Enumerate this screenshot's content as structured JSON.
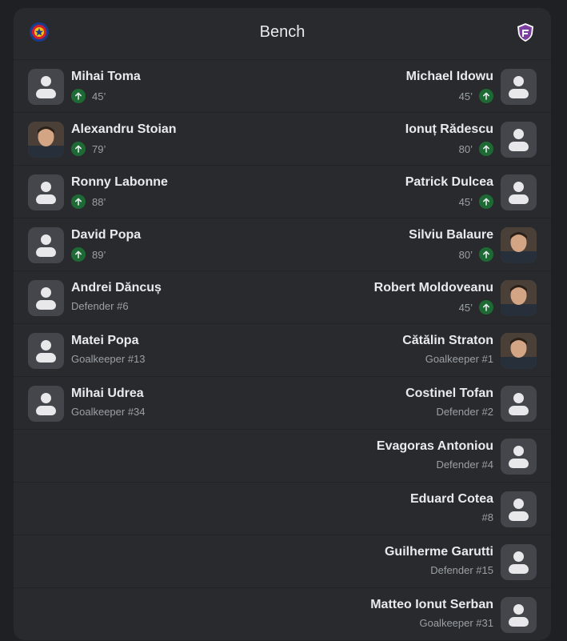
{
  "header": {
    "title": "Bench",
    "home_logo": "fcsb-crest-icon",
    "away_logo": "fc-arges-crest-icon"
  },
  "colors": {
    "card_bg": "#292a2d",
    "sub_arrow_bg": "#1e6a35",
    "text_primary": "#e8eaed",
    "text_secondary": "#9aa0a6"
  },
  "home": [
    {
      "name": "Mihai Toma",
      "sub": "45’",
      "subbed": true,
      "photo": false
    },
    {
      "name": "Alexandru Stoian",
      "sub": "79’",
      "subbed": true,
      "photo": true
    },
    {
      "name": "Ronny Labonne",
      "sub": "88’",
      "subbed": true,
      "photo": false
    },
    {
      "name": "David Popa",
      "sub": "89’",
      "subbed": true,
      "photo": false
    },
    {
      "name": "Andrei Dăncuș",
      "sub": "Defender #6",
      "subbed": false,
      "photo": false
    },
    {
      "name": "Matei Popa",
      "sub": "Goalkeeper #13",
      "subbed": false,
      "photo": false
    },
    {
      "name": "Mihai Udrea",
      "sub": "Goalkeeper #34",
      "subbed": false,
      "photo": false
    }
  ],
  "away": [
    {
      "name": "Michael Idowu",
      "sub": "45’",
      "subbed": true,
      "photo": false
    },
    {
      "name": "Ionuț Rădescu",
      "sub": "80’",
      "subbed": true,
      "photo": false
    },
    {
      "name": "Patrick Dulcea",
      "sub": "45’",
      "subbed": true,
      "photo": false
    },
    {
      "name": "Silviu Balaure",
      "sub": "80’",
      "subbed": true,
      "photo": true
    },
    {
      "name": "Robert Moldoveanu",
      "sub": "45’",
      "subbed": true,
      "photo": true
    },
    {
      "name": "Cătălin Straton",
      "sub": "Goalkeeper #1",
      "subbed": false,
      "photo": true
    },
    {
      "name": "Costinel Tofan",
      "sub": "Defender #2",
      "subbed": false,
      "photo": false
    },
    {
      "name": "Evagoras Antoniou",
      "sub": "Defender #4",
      "subbed": false,
      "photo": false
    },
    {
      "name": "Eduard Cotea",
      "sub": "#8",
      "subbed": false,
      "photo": false
    },
    {
      "name": "Guilherme Garutti",
      "sub": "Defender #15",
      "subbed": false,
      "photo": false
    },
    {
      "name": "Matteo Ionut Serban",
      "sub": "Goalkeeper #31",
      "subbed": false,
      "photo": false
    }
  ]
}
